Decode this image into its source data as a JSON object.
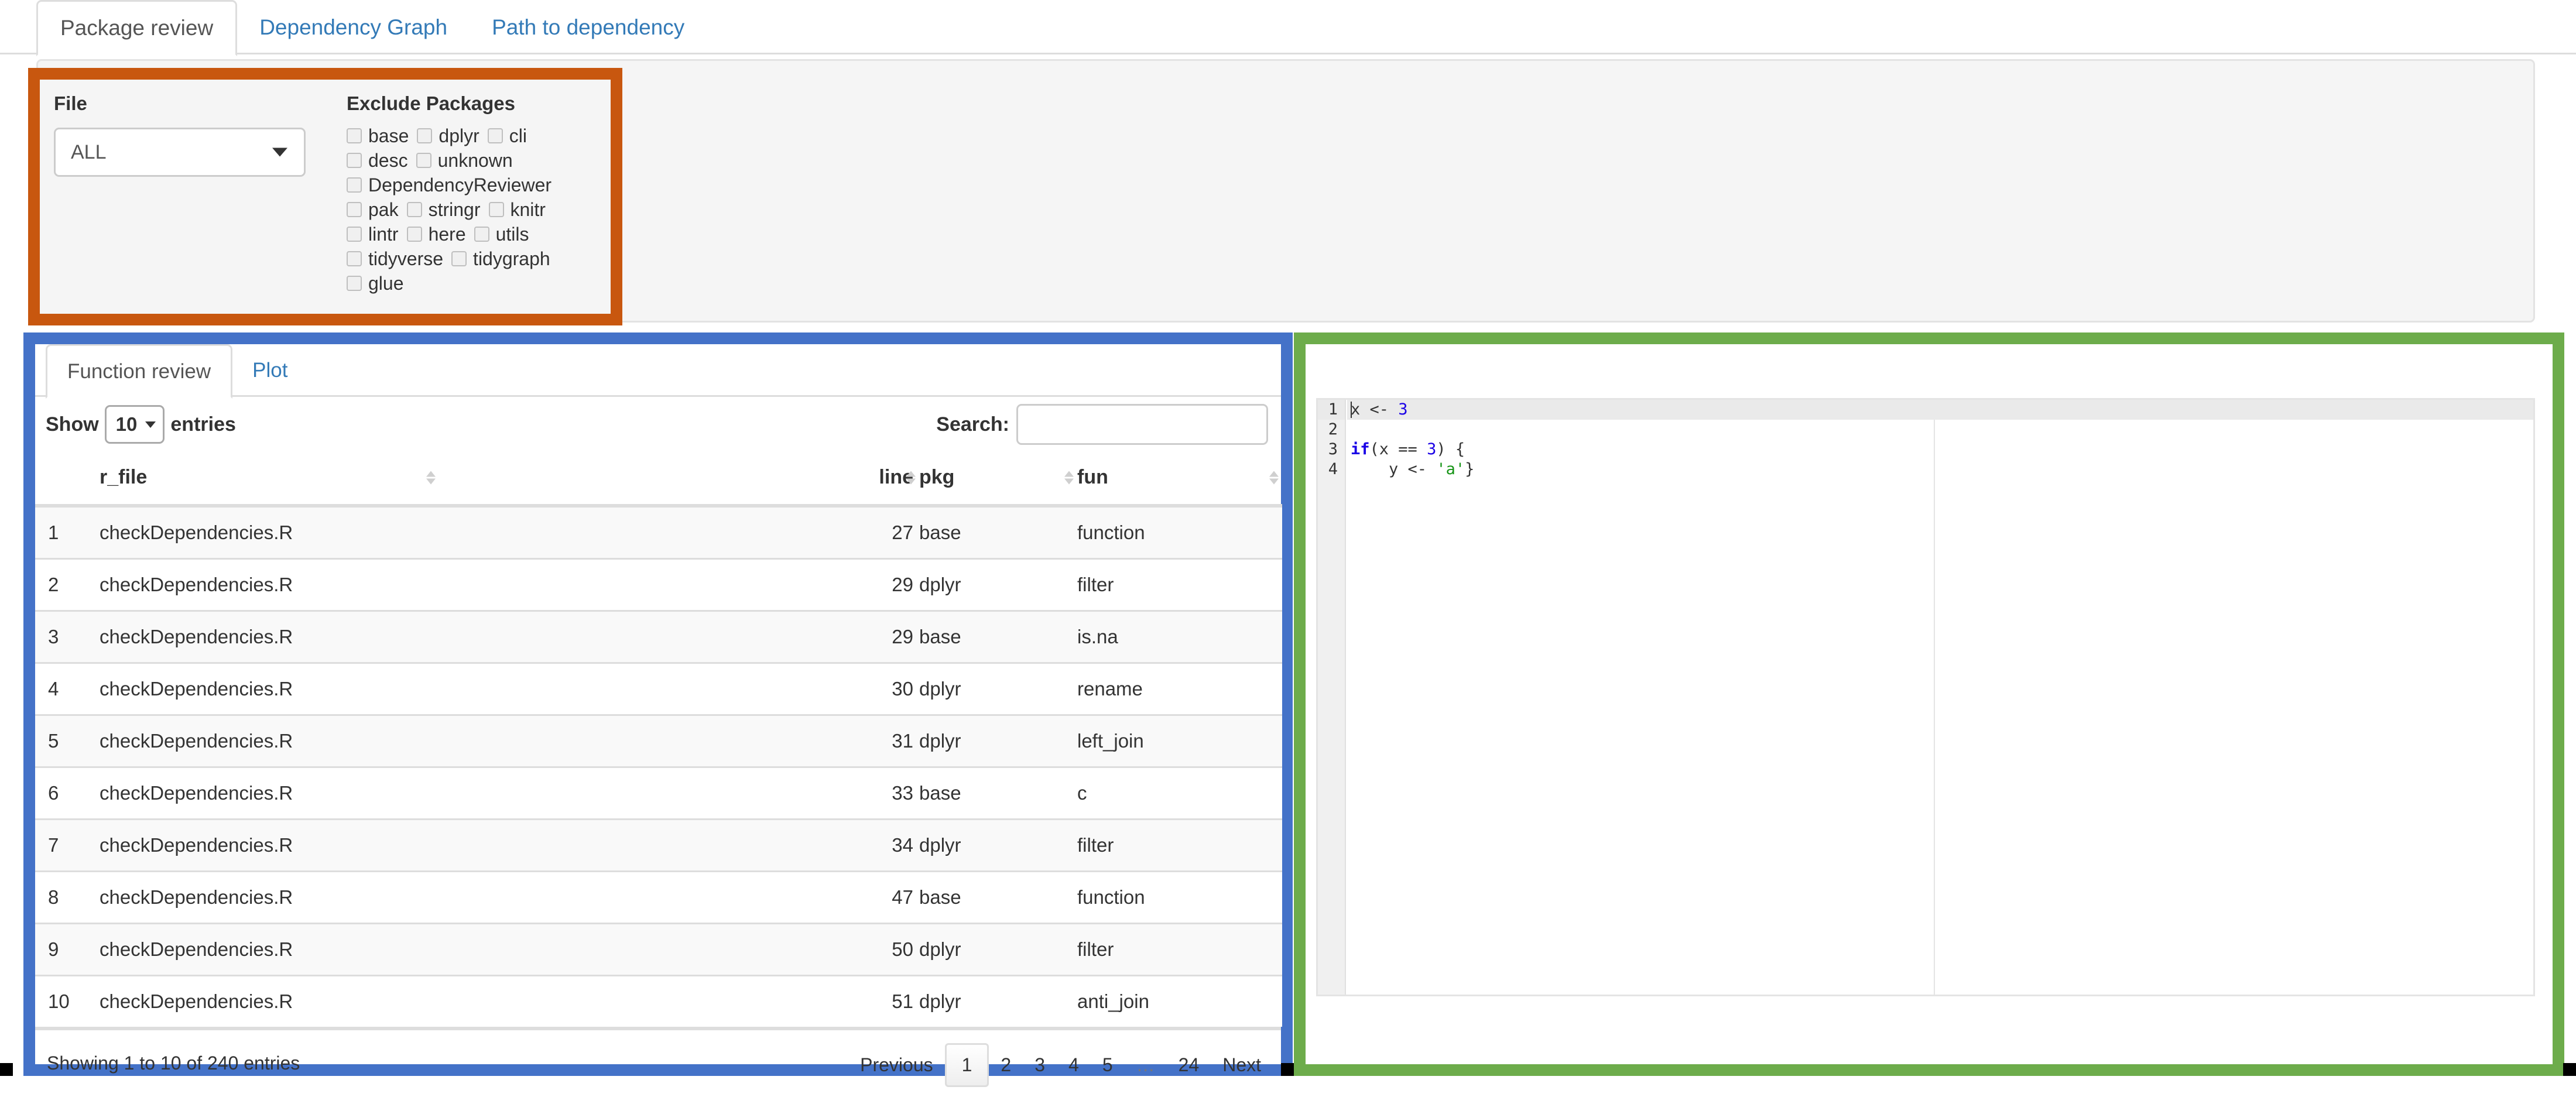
{
  "tabs": [
    {
      "label": "Package review",
      "active": true
    },
    {
      "label": "Dependency Graph",
      "active": false
    },
    {
      "label": "Path to dependency",
      "active": false
    }
  ],
  "filters": {
    "file": {
      "label": "File",
      "selected": "ALL",
      "caret_icon": "chevron-down-icon"
    },
    "exclude": {
      "label": "Exclude Packages",
      "packages": [
        {
          "name": "base",
          "checked": false
        },
        {
          "name": "dplyr",
          "checked": false
        },
        {
          "name": "cli",
          "checked": false
        },
        {
          "name": "desc",
          "checked": false
        },
        {
          "name": "unknown",
          "checked": false
        },
        {
          "name": "DependencyReviewer",
          "checked": false
        },
        {
          "name": "pak",
          "checked": false
        },
        {
          "name": "stringr",
          "checked": false
        },
        {
          "name": "knitr",
          "checked": false
        },
        {
          "name": "lintr",
          "checked": false
        },
        {
          "name": "here",
          "checked": false
        },
        {
          "name": "utils",
          "checked": false
        },
        {
          "name": "tidyverse",
          "checked": false
        },
        {
          "name": "tidygraph",
          "checked": false
        },
        {
          "name": "glue",
          "checked": false
        }
      ]
    }
  },
  "left_panel": {
    "tabs": [
      {
        "label": "Function review",
        "active": true
      },
      {
        "label": "Plot",
        "active": false
      }
    ],
    "table_controls": {
      "show_label": "Show",
      "entries_label": "entries",
      "page_length": "10",
      "search_label": "Search:",
      "search_value": "",
      "search_placeholder": ""
    },
    "table": {
      "columns": [
        "",
        "r_file",
        "line",
        "pkg",
        "fun"
      ],
      "rows": [
        {
          "idx": "1",
          "r_file": "checkDependencies.R",
          "line": "27",
          "pkg": "base",
          "fun": "function"
        },
        {
          "idx": "2",
          "r_file": "checkDependencies.R",
          "line": "29",
          "pkg": "dplyr",
          "fun": "filter"
        },
        {
          "idx": "3",
          "r_file": "checkDependencies.R",
          "line": "29",
          "pkg": "base",
          "fun": "is.na"
        },
        {
          "idx": "4",
          "r_file": "checkDependencies.R",
          "line": "30",
          "pkg": "dplyr",
          "fun": "rename"
        },
        {
          "idx": "5",
          "r_file": "checkDependencies.R",
          "line": "31",
          "pkg": "dplyr",
          "fun": "left_join"
        },
        {
          "idx": "6",
          "r_file": "checkDependencies.R",
          "line": "33",
          "pkg": "base",
          "fun": "c"
        },
        {
          "idx": "7",
          "r_file": "checkDependencies.R",
          "line": "34",
          "pkg": "dplyr",
          "fun": "filter"
        },
        {
          "idx": "8",
          "r_file": "checkDependencies.R",
          "line": "47",
          "pkg": "base",
          "fun": "function"
        },
        {
          "idx": "9",
          "r_file": "checkDependencies.R",
          "line": "50",
          "pkg": "dplyr",
          "fun": "filter"
        },
        {
          "idx": "10",
          "r_file": "checkDependencies.R",
          "line": "51",
          "pkg": "dplyr",
          "fun": "anti_join"
        }
      ]
    },
    "footer": {
      "info": "Showing 1 to 10 of 240 entries",
      "pagination": [
        {
          "label": "Previous",
          "current": false
        },
        {
          "label": "1",
          "current": true
        },
        {
          "label": "2",
          "current": false
        },
        {
          "label": "3",
          "current": false
        },
        {
          "label": "4",
          "current": false
        },
        {
          "label": "5",
          "current": false
        },
        {
          "label": "…",
          "current": false,
          "dots": true
        },
        {
          "label": "24",
          "current": false
        },
        {
          "label": "Next",
          "current": false
        }
      ]
    }
  },
  "right_panel": {
    "editor": {
      "line_numbers": [
        "1",
        "2",
        "3",
        "4"
      ],
      "lines": [
        "x <- 3",
        "",
        "if(x == 3) {",
        "    y <- 'a'}"
      ]
    }
  },
  "colors": {
    "highlight_orange": "#c8570f",
    "highlight_blue": "#4472c8",
    "highlight_green": "#6dac4b",
    "link_blue": "#337ab7",
    "code_keyword": "#1a00e6",
    "code_number": "#1a00e6",
    "code_string": "#169416"
  }
}
